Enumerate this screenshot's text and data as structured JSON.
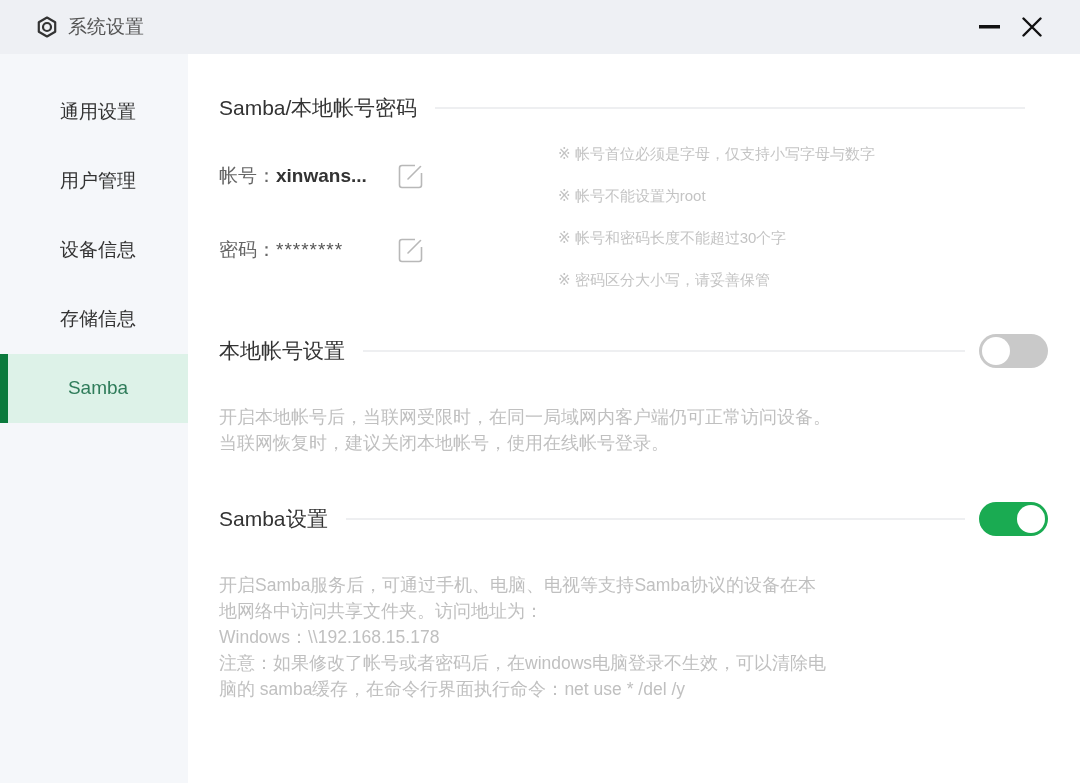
{
  "window": {
    "title": "系统设置"
  },
  "sidebar": {
    "items": [
      {
        "label": "通用设置",
        "selected": false
      },
      {
        "label": "用户管理",
        "selected": false
      },
      {
        "label": "设备信息",
        "selected": false
      },
      {
        "label": "存储信息",
        "selected": false
      },
      {
        "label": "Samba",
        "selected": true
      }
    ]
  },
  "sections": [
    {
      "kind": "account",
      "title": "Samba/本地帐号密码",
      "fields": [
        {
          "kind": "text",
          "label": "帐号：",
          "value": "xinwans..."
        },
        {
          "kind": "password",
          "label": "密码：",
          "value": "********"
        }
      ],
      "hints": [
        "※ 帐号首位必须是字母，仅支持小写字母与数字",
        "※ 帐号不能设置为root",
        "※ 帐号和密码长度不能超过30个字",
        "※ 密码区分大小写，请妥善保管"
      ]
    },
    {
      "kind": "toggle",
      "title": "本地帐号设置",
      "on": false,
      "description": [
        "开启本地帐号后，当联网受限时，在同一局域网内客户端仍可正常访问设备。",
        "当联网恢复时，建议关闭本地帐号，使用在线帐号登录。"
      ]
    },
    {
      "kind": "toggle",
      "title": "Samba设置",
      "on": true,
      "description": [
        "开启Samba服务后，可通过手机、电脑、电视等支持Samba协议的设备在本",
        "地网络中访问共享文件夹。访问地址为：",
        "Windows：\\\\192.168.15.178",
        "注意：如果修改了帐号或者密码后，在windows电脑登录不生效，可以清除电",
        "脑的 samba缓存，在命令行界面执行命令：net use * /del /y"
      ]
    }
  ]
}
